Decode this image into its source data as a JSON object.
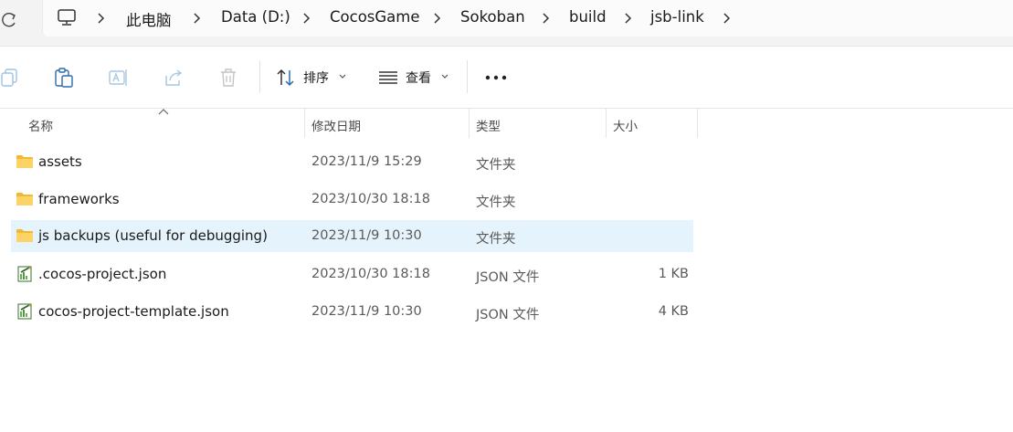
{
  "breadcrumb": {
    "items": [
      "此电脑",
      "Data (D:)",
      "CocosGame",
      "Sokoban",
      "build",
      "jsb-link"
    ]
  },
  "toolbar": {
    "sort_label": "排序",
    "view_label": "查看",
    "more_label": "···"
  },
  "columns": {
    "name": "名称",
    "modified": "修改日期",
    "type": "类型",
    "size": "大小"
  },
  "files": [
    {
      "name": "assets",
      "modified": "2023/11/9 15:29",
      "type": "文件夹",
      "size": "",
      "icon": "folder-icon",
      "selected": false
    },
    {
      "name": "frameworks",
      "modified": "2023/10/30 18:18",
      "type": "文件夹",
      "size": "",
      "icon": "folder-icon",
      "selected": false
    },
    {
      "name": "js backups (useful for debugging)",
      "modified": "2023/11/9 10:30",
      "type": "文件夹",
      "size": "",
      "icon": "folder-icon",
      "selected": true
    },
    {
      "name": ".cocos-project.json",
      "modified": "2023/10/30 18:18",
      "type": "JSON 文件",
      "size": "1 KB",
      "icon": "json-file-icon",
      "selected": false
    },
    {
      "name": "cocos-project-template.json",
      "modified": "2023/11/9 10:30",
      "type": "JSON 文件",
      "size": "4 KB",
      "icon": "json-file-icon",
      "selected": false
    }
  ],
  "colors": {
    "selection": "#e5f3fd",
    "folder": "#f8c94a",
    "accent": "#0067c0"
  }
}
